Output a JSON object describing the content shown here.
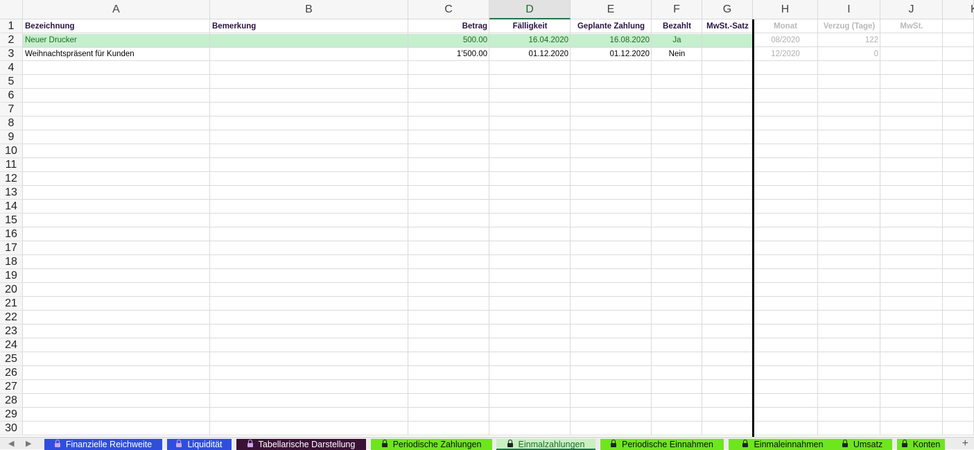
{
  "columns": [
    "A",
    "B",
    "C",
    "D",
    "E",
    "F",
    "G",
    "H",
    "I",
    "J",
    "K"
  ],
  "active_column": "D",
  "rows": [
    "1",
    "2",
    "3",
    "4",
    "5",
    "6",
    "7",
    "8",
    "9",
    "10",
    "11",
    "12",
    "13",
    "14",
    "15",
    "16",
    "17",
    "18",
    "19",
    "20",
    "21",
    "22",
    "23",
    "24",
    "25",
    "26",
    "27",
    "28",
    "29",
    "30"
  ],
  "headers": {
    "A": "Bezeichnung",
    "B": "Bemerkung",
    "C": "Betrag",
    "D": "Fälligkeit",
    "E": "Geplante Zahlung",
    "F": "Bezahlt",
    "G": "MwSt.-Satz",
    "H": "Monat",
    "I": "Verzug (Tage)",
    "J": "MwSt."
  },
  "data_rows": [
    {
      "A": "Neuer Drucker",
      "B": "",
      "C": "500.00",
      "D": "16.04.2020",
      "E": "16.08.2020",
      "F": "Ja",
      "G": "",
      "H": "08/2020",
      "I": "122",
      "J": "",
      "highlight": "#c6efce"
    },
    {
      "A": "Weihnachtspräsent für Kunden",
      "B": "",
      "C": "1’500.00",
      "D": "01.12.2020",
      "E": "01.12.2020",
      "F": "Nein",
      "G": "",
      "H": "12/2020",
      "I": "0",
      "J": ""
    }
  ],
  "tabs": [
    {
      "label": "Finanzielle Reichweite",
      "bg": "#2f4ee0",
      "fg": "#ffffff",
      "locked": true
    },
    {
      "label": "Liquidität",
      "bg": "#2f4ee0",
      "fg": "#ffffff",
      "locked": true
    },
    {
      "label": "Tabellarische Darstellung",
      "bg": "#3a1236",
      "fg": "#ffffff",
      "locked": true
    },
    {
      "label": "Periodische Zahlungen",
      "bg": "#6ee61d",
      "fg": "#111111",
      "locked": true
    },
    {
      "label": "Einmalzahlungen",
      "bg": "#c8f0c0",
      "fg": "#1e6b32",
      "locked": true,
      "active": true
    },
    {
      "label": "Periodische Einnahmen",
      "bg": "#6ee61d",
      "fg": "#111111",
      "locked": true
    },
    {
      "label": "Einmaleinnahmen",
      "bg": "#6ee61d",
      "fg": "#111111",
      "locked": true
    },
    {
      "label": "Umsatz",
      "bg": "#6ee61d",
      "fg": "#111111",
      "locked": true
    },
    {
      "label": "Konten",
      "bg": "#6ee61d",
      "fg": "#111111",
      "locked": true
    }
  ],
  "nav": {
    "prev": "◀",
    "next": "▶",
    "add": "+"
  }
}
